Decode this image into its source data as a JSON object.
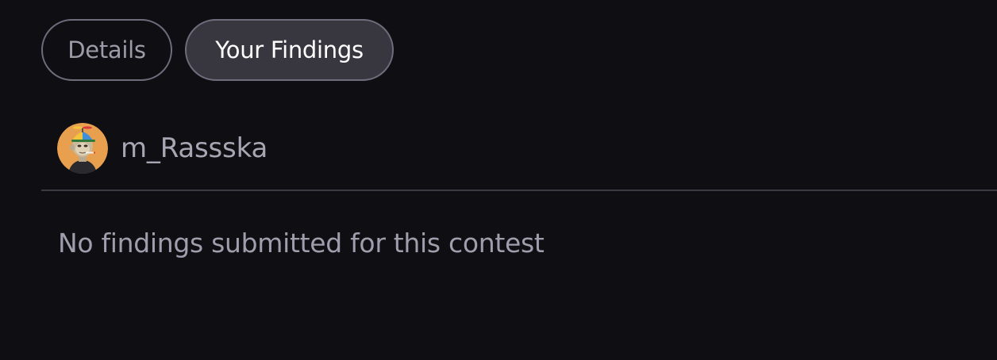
{
  "tabs": {
    "details_label": "Details",
    "findings_label": "Your Findings",
    "active": "Your Findings"
  },
  "user": {
    "name": "m_Rassska",
    "avatar_icon": "bored-ape-avatar"
  },
  "findings": {
    "empty_message": "No findings submitted for this contest"
  },
  "colors": {
    "background": "#0f0e13",
    "active_tab_bg": "#38363f",
    "tab_border": "#6f6c7c",
    "muted_text": "#a09dac",
    "avatar_bg": "#e9a04e"
  }
}
